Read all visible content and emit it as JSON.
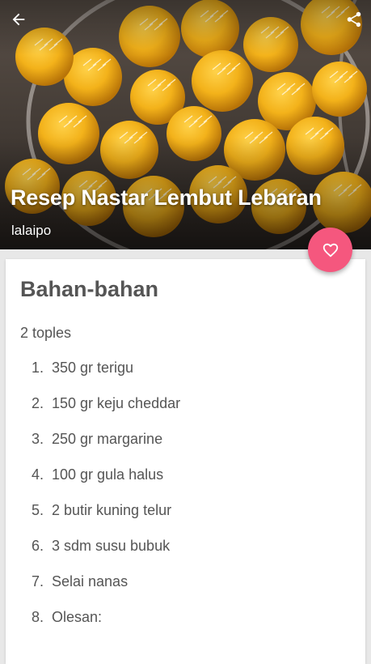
{
  "header": {
    "back_icon": "arrow-left-icon",
    "share_icon": "share-icon",
    "title": "Resep Nastar Lembut Lebaran",
    "author": "lalaipo"
  },
  "favorite": {
    "icon": "heart-outline-icon",
    "color": "#f5577e"
  },
  "ingredients": {
    "heading": "Bahan-bahan",
    "yield": "2 toples",
    "items": [
      {
        "num": "1.",
        "text": "350 gr terigu"
      },
      {
        "num": "2.",
        "text": "150 gr keju cheddar"
      },
      {
        "num": "3.",
        "text": "250 gr margarine"
      },
      {
        "num": "4.",
        "text": "100 gr gula halus"
      },
      {
        "num": "5.",
        "text": "2 butir kuning telur"
      },
      {
        "num": "6.",
        "text": "3 sdm susu bubuk"
      },
      {
        "num": "7.",
        "text": "Selai nanas"
      },
      {
        "num": "8.",
        "text": "Olesan:"
      }
    ]
  }
}
